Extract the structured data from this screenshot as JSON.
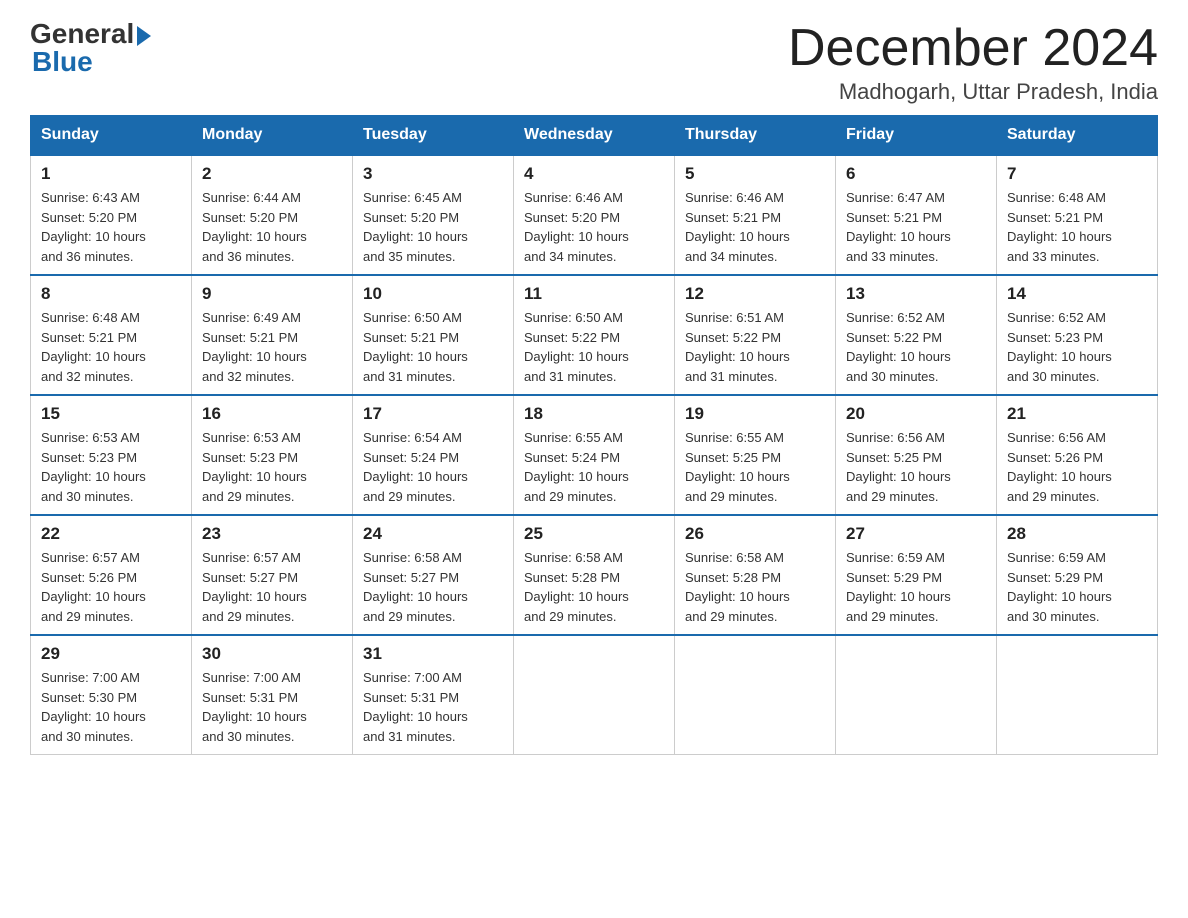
{
  "logo": {
    "general": "General",
    "blue": "Blue"
  },
  "title": "December 2024",
  "location": "Madhogarh, Uttar Pradesh, India",
  "days_of_week": [
    "Sunday",
    "Monday",
    "Tuesday",
    "Wednesday",
    "Thursday",
    "Friday",
    "Saturday"
  ],
  "weeks": [
    [
      {
        "day": "1",
        "sunrise": "6:43 AM",
        "sunset": "5:20 PM",
        "daylight": "10 hours and 36 minutes."
      },
      {
        "day": "2",
        "sunrise": "6:44 AM",
        "sunset": "5:20 PM",
        "daylight": "10 hours and 36 minutes."
      },
      {
        "day": "3",
        "sunrise": "6:45 AM",
        "sunset": "5:20 PM",
        "daylight": "10 hours and 35 minutes."
      },
      {
        "day": "4",
        "sunrise": "6:46 AM",
        "sunset": "5:20 PM",
        "daylight": "10 hours and 34 minutes."
      },
      {
        "day": "5",
        "sunrise": "6:46 AM",
        "sunset": "5:21 PM",
        "daylight": "10 hours and 34 minutes."
      },
      {
        "day": "6",
        "sunrise": "6:47 AM",
        "sunset": "5:21 PM",
        "daylight": "10 hours and 33 minutes."
      },
      {
        "day": "7",
        "sunrise": "6:48 AM",
        "sunset": "5:21 PM",
        "daylight": "10 hours and 33 minutes."
      }
    ],
    [
      {
        "day": "8",
        "sunrise": "6:48 AM",
        "sunset": "5:21 PM",
        "daylight": "10 hours and 32 minutes."
      },
      {
        "day": "9",
        "sunrise": "6:49 AM",
        "sunset": "5:21 PM",
        "daylight": "10 hours and 32 minutes."
      },
      {
        "day": "10",
        "sunrise": "6:50 AM",
        "sunset": "5:21 PM",
        "daylight": "10 hours and 31 minutes."
      },
      {
        "day": "11",
        "sunrise": "6:50 AM",
        "sunset": "5:22 PM",
        "daylight": "10 hours and 31 minutes."
      },
      {
        "day": "12",
        "sunrise": "6:51 AM",
        "sunset": "5:22 PM",
        "daylight": "10 hours and 31 minutes."
      },
      {
        "day": "13",
        "sunrise": "6:52 AM",
        "sunset": "5:22 PM",
        "daylight": "10 hours and 30 minutes."
      },
      {
        "day": "14",
        "sunrise": "6:52 AM",
        "sunset": "5:23 PM",
        "daylight": "10 hours and 30 minutes."
      }
    ],
    [
      {
        "day": "15",
        "sunrise": "6:53 AM",
        "sunset": "5:23 PM",
        "daylight": "10 hours and 30 minutes."
      },
      {
        "day": "16",
        "sunrise": "6:53 AM",
        "sunset": "5:23 PM",
        "daylight": "10 hours and 29 minutes."
      },
      {
        "day": "17",
        "sunrise": "6:54 AM",
        "sunset": "5:24 PM",
        "daylight": "10 hours and 29 minutes."
      },
      {
        "day": "18",
        "sunrise": "6:55 AM",
        "sunset": "5:24 PM",
        "daylight": "10 hours and 29 minutes."
      },
      {
        "day": "19",
        "sunrise": "6:55 AM",
        "sunset": "5:25 PM",
        "daylight": "10 hours and 29 minutes."
      },
      {
        "day": "20",
        "sunrise": "6:56 AM",
        "sunset": "5:25 PM",
        "daylight": "10 hours and 29 minutes."
      },
      {
        "day": "21",
        "sunrise": "6:56 AM",
        "sunset": "5:26 PM",
        "daylight": "10 hours and 29 minutes."
      }
    ],
    [
      {
        "day": "22",
        "sunrise": "6:57 AM",
        "sunset": "5:26 PM",
        "daylight": "10 hours and 29 minutes."
      },
      {
        "day": "23",
        "sunrise": "6:57 AM",
        "sunset": "5:27 PM",
        "daylight": "10 hours and 29 minutes."
      },
      {
        "day": "24",
        "sunrise": "6:58 AM",
        "sunset": "5:27 PM",
        "daylight": "10 hours and 29 minutes."
      },
      {
        "day": "25",
        "sunrise": "6:58 AM",
        "sunset": "5:28 PM",
        "daylight": "10 hours and 29 minutes."
      },
      {
        "day": "26",
        "sunrise": "6:58 AM",
        "sunset": "5:28 PM",
        "daylight": "10 hours and 29 minutes."
      },
      {
        "day": "27",
        "sunrise": "6:59 AM",
        "sunset": "5:29 PM",
        "daylight": "10 hours and 29 minutes."
      },
      {
        "day": "28",
        "sunrise": "6:59 AM",
        "sunset": "5:29 PM",
        "daylight": "10 hours and 30 minutes."
      }
    ],
    [
      {
        "day": "29",
        "sunrise": "7:00 AM",
        "sunset": "5:30 PM",
        "daylight": "10 hours and 30 minutes."
      },
      {
        "day": "30",
        "sunrise": "7:00 AM",
        "sunset": "5:31 PM",
        "daylight": "10 hours and 30 minutes."
      },
      {
        "day": "31",
        "sunrise": "7:00 AM",
        "sunset": "5:31 PM",
        "daylight": "10 hours and 31 minutes."
      },
      null,
      null,
      null,
      null
    ]
  ],
  "labels": {
    "sunrise": "Sunrise:",
    "sunset": "Sunset:",
    "daylight": "Daylight:"
  }
}
